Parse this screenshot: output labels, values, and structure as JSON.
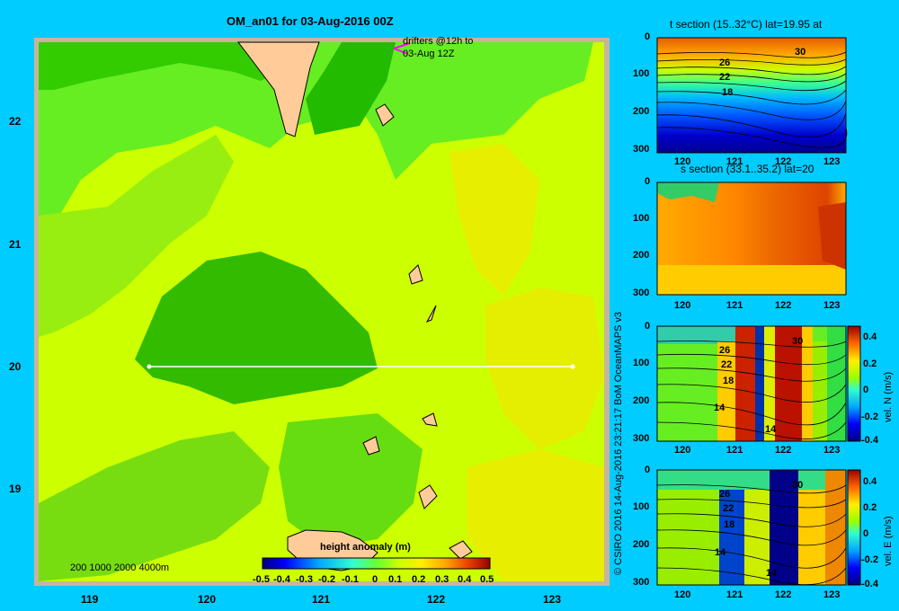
{
  "main_title": "OM_an01 for 03-Aug-2016 00Z",
  "drifter_note": [
    "drifters @12h to",
    "03-Aug 12Z"
  ],
  "depth_legend": "200  1000  2000  4000m",
  "colorbar_title": "height anomaly (m)",
  "credit": "© CSIRO 2016   14-Aug-2016 23:21:17 BoM OceanMAPS v3",
  "colors": {
    "background": "#00ccff",
    "land": "#ffcc99",
    "shelf": "#c8b49a",
    "transect": "#ffffff",
    "drifter": "#ff00ff"
  },
  "chart_data": [
    {
      "type": "heatmap",
      "title": "OM_an01 for 03-Aug-2016 00Z",
      "xlim": [
        118.5,
        123.5
      ],
      "ylim": [
        18.3,
        22.7
      ],
      "x_ticks": [
        "119",
        "120",
        "121",
        "122",
        "123"
      ],
      "y_ticks": [
        "19",
        "20",
        "21",
        "22"
      ],
      "colorbar": {
        "label": "height anomaly (m)",
        "range": [
          -0.5,
          0.5
        ],
        "ticks": [
          "-0.5",
          "-0.4",
          "-0.3",
          "-0.2",
          "-0.1",
          "0",
          "0.1",
          "0.2",
          "0.3",
          "0.4",
          "0.5"
        ]
      },
      "transect": {
        "lat": 20,
        "lon_start": 119.5,
        "lon_end": 123.2
      }
    },
    {
      "type": "heatmap",
      "title": "t section (15..32°C) lat=19.95 at",
      "x_ticks": [
        "120",
        "121",
        "122",
        "123"
      ],
      "y_ticks": [
        "0",
        "100",
        "200",
        "300"
      ],
      "ylim": [
        300,
        0
      ],
      "contour_labels": [
        "30",
        "26",
        "22",
        "18"
      ]
    },
    {
      "type": "heatmap",
      "title": "s section (33.1..35.2) lat=20",
      "x_ticks": [
        "120",
        "121",
        "122",
        "123"
      ],
      "y_ticks": [
        "0",
        "100",
        "200",
        "300"
      ],
      "ylim": [
        300,
        0
      ]
    },
    {
      "type": "heatmap",
      "title": "",
      "x_ticks": [
        "120",
        "121",
        "122",
        "123"
      ],
      "y_ticks": [
        "0",
        "100",
        "200",
        "300"
      ],
      "ylim": [
        300,
        0
      ],
      "contour_labels": [
        "26",
        "30",
        "22",
        "18",
        "14",
        "14"
      ],
      "colorbar": {
        "label": "vel. N (m/s)",
        "range": [
          -0.4,
          0.4
        ],
        "ticks": [
          "0.4",
          "0.2",
          "0",
          "-0.2",
          "-0.4"
        ]
      }
    },
    {
      "type": "heatmap",
      "title": "",
      "x_ticks": [
        "120",
        "121",
        "122",
        "123"
      ],
      "y_ticks": [
        "0",
        "100",
        "200",
        "300"
      ],
      "ylim": [
        300,
        0
      ],
      "contour_labels": [
        "26",
        "22",
        "30",
        "18",
        "14",
        "14"
      ],
      "colorbar": {
        "label": "vel. E (m/s)",
        "range": [
          -0.4,
          0.4
        ],
        "ticks": [
          "0.4",
          "0.2",
          "0",
          "-0.2",
          "-0.4"
        ]
      }
    }
  ]
}
